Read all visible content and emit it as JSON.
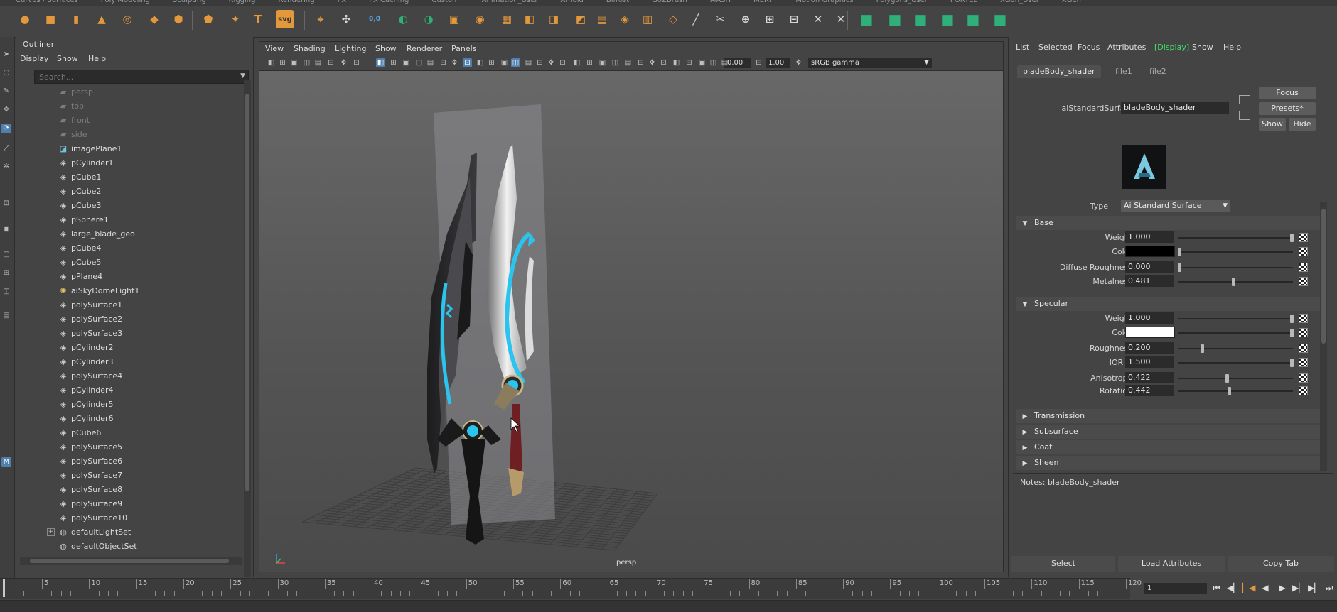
{
  "shelf": {
    "tabs": [
      "Curves / Surfaces",
      "Poly Modeling",
      "Sculpting",
      "Rigging",
      "Rendering",
      "FX",
      "FX Caching",
      "Custom",
      "Animation_User",
      "Arnold",
      "Bifrost",
      "GoZBrush",
      "MASH",
      "MERT",
      "Motion Graphics",
      "Polygons_User",
      "PORTEL",
      "XGen_User",
      "XGen"
    ],
    "icons": [
      "sphere",
      "cube",
      "cylinder",
      "cone",
      "torus",
      "plane",
      "disc",
      "platonic",
      "star",
      "type",
      "svg",
      "bevel",
      "pivot",
      "snap-point",
      "combine",
      "separate",
      "extract",
      "smooth",
      "bridge",
      "boolean",
      "mirror",
      "append",
      "extrude",
      "bevel2",
      "bridge2",
      "bevel3",
      "insert-edge",
      "multicut",
      "target-weld",
      "quad-draw",
      "uv",
      "unfold",
      "layout",
      "green-cube-1",
      "green-cube-2",
      "green-cube-3",
      "green-cube-4",
      "green-cube-5",
      "green-cube-6"
    ],
    "icon_text": {
      "type": "T",
      "svg": "svg",
      "snap_value": "0,0"
    }
  },
  "toolbox": {
    "icons": [
      "select-arrow",
      "lasso",
      "paint-select",
      "move",
      "rotate",
      "scale",
      "soft-mod",
      "show-manipulator",
      "last-tool",
      "layout-single",
      "layout-four",
      "layout-persp-outliner",
      "layout-render",
      "maya-logo"
    ]
  },
  "outliner": {
    "title": "Outliner",
    "menu": [
      "Display",
      "Show",
      "Help"
    ],
    "search_placeholder": "Search...",
    "items": [
      {
        "label": "persp",
        "icon": "camera",
        "dim": true
      },
      {
        "label": "top",
        "icon": "camera",
        "dim": true
      },
      {
        "label": "front",
        "icon": "camera",
        "dim": true
      },
      {
        "label": "side",
        "icon": "camera",
        "dim": true
      },
      {
        "label": "imagePlane1",
        "icon": "image-plane",
        "dim": false
      },
      {
        "label": "pCylinder1",
        "icon": "mesh",
        "dim": false
      },
      {
        "label": "pCube1",
        "icon": "mesh",
        "dim": false
      },
      {
        "label": "pCube2",
        "icon": "mesh",
        "dim": false
      },
      {
        "label": "pCube3",
        "icon": "mesh",
        "dim": false
      },
      {
        "label": "pSphere1",
        "icon": "mesh",
        "dim": false
      },
      {
        "label": "large_blade_geo",
        "icon": "mesh",
        "dim": false
      },
      {
        "label": "pCube4",
        "icon": "mesh",
        "dim": false
      },
      {
        "label": "pCube5",
        "icon": "mesh",
        "dim": false
      },
      {
        "label": "pPlane4",
        "icon": "mesh",
        "dim": false
      },
      {
        "label": "aiSkyDomeLight1",
        "icon": "light",
        "dim": false
      },
      {
        "label": "polySurface1",
        "icon": "mesh",
        "dim": false
      },
      {
        "label": "polySurface2",
        "icon": "mesh",
        "dim": false
      },
      {
        "label": "polySurface3",
        "icon": "mesh",
        "dim": false
      },
      {
        "label": "pCylinder2",
        "icon": "mesh",
        "dim": false
      },
      {
        "label": "pCylinder3",
        "icon": "mesh",
        "dim": false
      },
      {
        "label": "polySurface4",
        "icon": "mesh",
        "dim": false
      },
      {
        "label": "pCylinder4",
        "icon": "mesh",
        "dim": false
      },
      {
        "label": "pCylinder5",
        "icon": "mesh",
        "dim": false
      },
      {
        "label": "pCylinder6",
        "icon": "mesh",
        "dim": false
      },
      {
        "label": "pCube6",
        "icon": "mesh",
        "dim": false
      },
      {
        "label": "polySurface5",
        "icon": "mesh",
        "dim": false
      },
      {
        "label": "polySurface6",
        "icon": "mesh",
        "dim": false
      },
      {
        "label": "polySurface7",
        "icon": "mesh",
        "dim": false
      },
      {
        "label": "polySurface8",
        "icon": "mesh",
        "dim": false
      },
      {
        "label": "polySurface9",
        "icon": "mesh",
        "dim": false
      },
      {
        "label": "polySurface10",
        "icon": "mesh",
        "dim": false
      },
      {
        "label": "defaultLightSet",
        "icon": "set",
        "dim": false,
        "expandable": true
      },
      {
        "label": "defaultObjectSet",
        "icon": "set",
        "dim": false
      }
    ]
  },
  "viewport": {
    "menu": [
      "View",
      "Shading",
      "Lighting",
      "Show",
      "Renderer",
      "Panels"
    ],
    "exposure": "0.00",
    "gamma": "1.00",
    "colorspace": "sRGB gamma",
    "camera_label": "persp"
  },
  "attribute_editor": {
    "menu": [
      "List",
      "Selected",
      "Focus",
      "Attributes",
      "[Display]",
      "Show",
      "Help"
    ],
    "tabs": [
      "bladeBody_shader",
      "file1",
      "file2"
    ],
    "node_type_label": "aiStandardSurface:",
    "node_name": "bladeBody_shader",
    "buttons": {
      "focus": "Focus",
      "presets": "Presets*",
      "show": "Show",
      "hide": "Hide"
    },
    "type_label": "Type",
    "type_value": "Ai Standard Surface",
    "sections": {
      "base": "Base",
      "specular": "Specular",
      "transmission": "Transmission",
      "subsurface": "Subsurface",
      "coat": "Coat",
      "sheen": "Sheen"
    },
    "base": {
      "weight": {
        "label": "Weight",
        "value": "1.000"
      },
      "color": {
        "label": "Color",
        "swatch": "#000000"
      },
      "diffuse_roughness": {
        "label": "Diffuse Roughness",
        "value": "0.000"
      },
      "metalness": {
        "label": "Metalness",
        "value": "0.481"
      }
    },
    "specular": {
      "weight": {
        "label": "Weight",
        "value": "1.000"
      },
      "color": {
        "label": "Color",
        "swatch": "#ffffff"
      },
      "roughness": {
        "label": "Roughness",
        "value": "0.200"
      },
      "ior": {
        "label": "IOR ≡",
        "value": "1.500"
      },
      "anisotropy": {
        "label": "Anisotropy",
        "value": "0.422"
      },
      "rotation": {
        "label": "Rotation",
        "value": "0.442"
      }
    },
    "notes_label": "Notes:  bladeBody_shader",
    "footer": {
      "select": "Select",
      "load": "Load Attributes",
      "copy": "Copy Tab"
    }
  },
  "timeline": {
    "ticks": [
      "5",
      "10",
      "15",
      "20",
      "25",
      "30",
      "35",
      "40",
      "45",
      "50",
      "55",
      "60",
      "65",
      "70",
      "75",
      "80",
      "85",
      "90",
      "95",
      "100",
      "105",
      "110",
      "115",
      "120"
    ],
    "current_frame": "1"
  },
  "colors": {
    "accent": "#4f80ad",
    "display_tag": "#3ee06a",
    "shelf_orange": "#e3983c",
    "shelf_green": "#2fb07a",
    "glow": "#2bc4ee"
  }
}
